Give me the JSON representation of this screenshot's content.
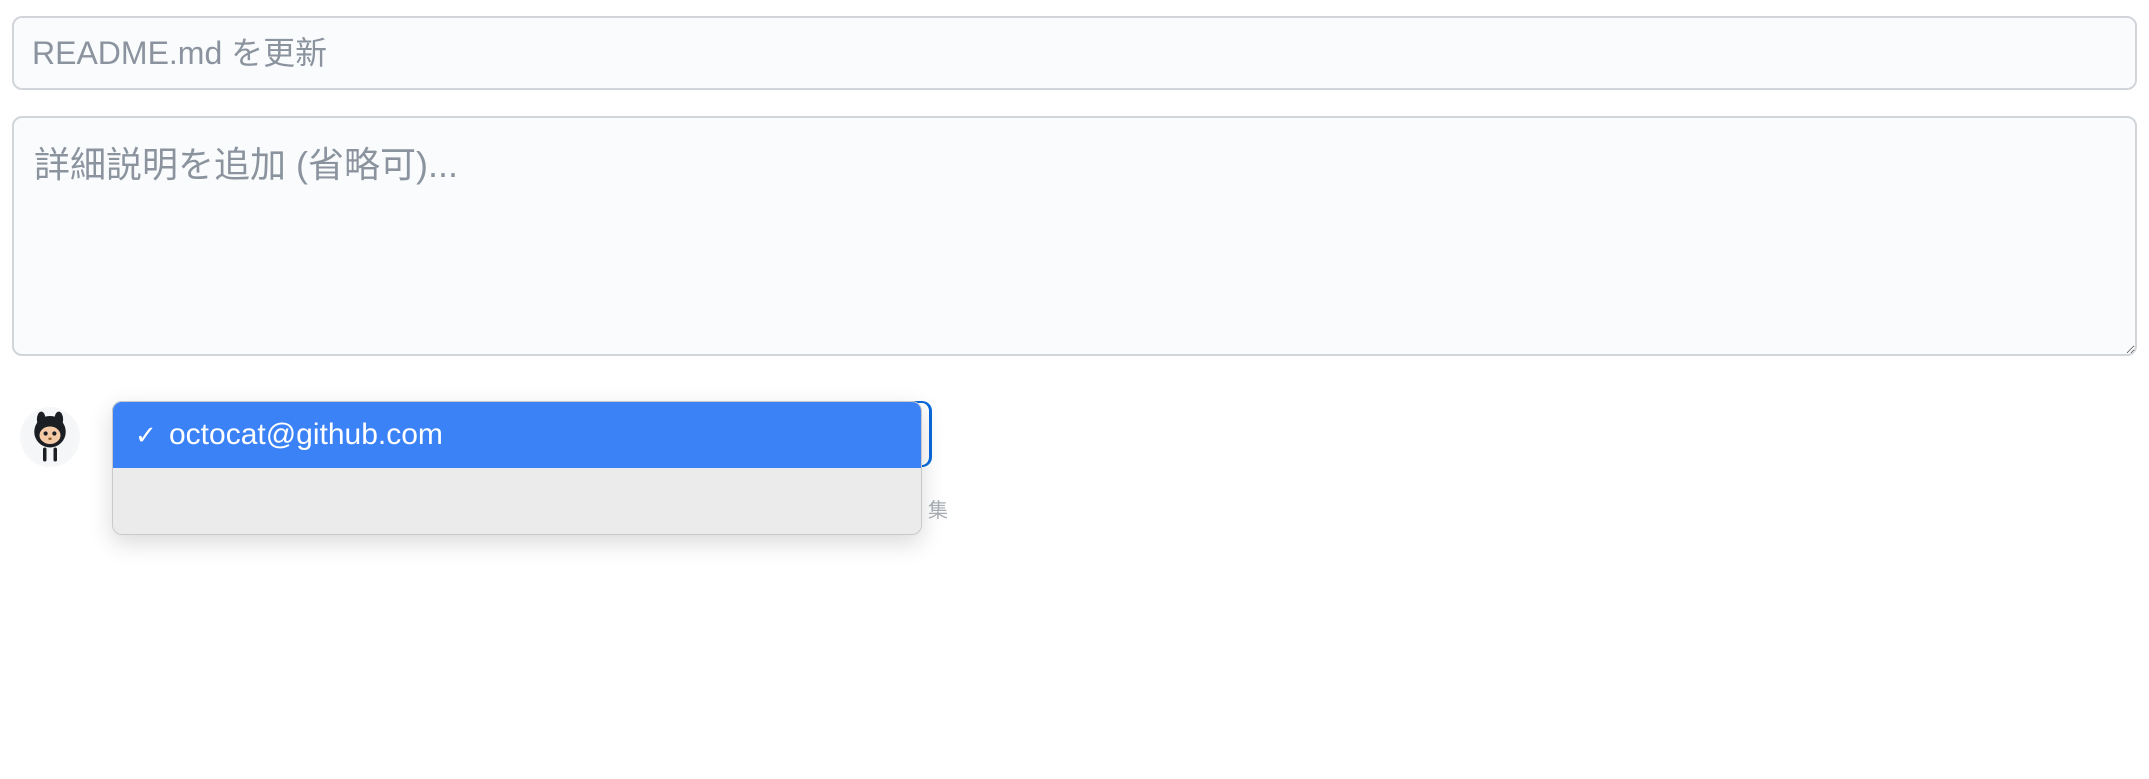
{
  "commit": {
    "summary_placeholder": "README.md を更新",
    "description_placeholder": "詳細説明を追加 (省略可)...",
    "summary_value": "",
    "description_value": ""
  },
  "author_dropdown": {
    "selected": "octocat@github.com",
    "options": [
      {
        "label": "octocat@github.com",
        "selected": true
      }
    ]
  },
  "icons": {
    "avatar": "octocat-avatar",
    "check": "✓"
  },
  "partial_text": "集"
}
